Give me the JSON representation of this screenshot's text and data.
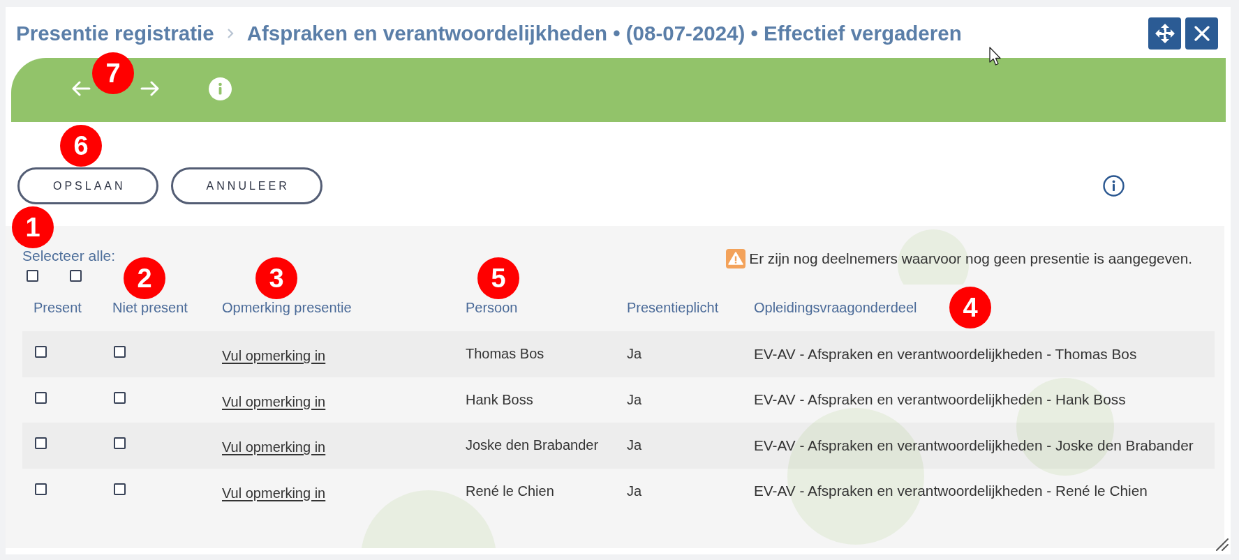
{
  "breadcrumb": [
    {
      "label": "Presentie registratie"
    },
    {
      "label": "Afspraken en verantwoordelijkheden • (08-07-2024) • Effectief vergaderen"
    }
  ],
  "actions": [
    {
      "label": "OPSLAAN"
    },
    {
      "label": "ANNULEER"
    }
  ],
  "select_all": {
    "label": "Selecteer alle:",
    "checkboxes": [
      {
        "checked": false
      },
      {
        "checked": false
      }
    ]
  },
  "warning": {
    "text": "Er zijn nog deelnemers waarvoor nog geen presentie is aangegeven."
  },
  "table": {
    "columns": [
      "Present",
      "Niet present",
      "Opmerking presentie",
      "Persoon",
      "Presentieplicht",
      "Opleidingsvraagonderdeel"
    ],
    "rows": [
      {
        "present_checked": false,
        "not_present_checked": false,
        "remark": "Vul opmerking in",
        "person": "Thomas Bos",
        "obligation": "Ja",
        "component": "EV-AV - Afspraken en verantwoordelijkheden - Thomas Bos"
      },
      {
        "present_checked": false,
        "not_present_checked": false,
        "remark": "Vul opmerking in",
        "person": "Hank Boss",
        "obligation": "Ja",
        "component": "EV-AV - Afspraken en verantwoordelijkheden - Hank Boss"
      },
      {
        "present_checked": false,
        "not_present_checked": false,
        "remark": "Vul opmerking in",
        "person": "Joske den Brabander",
        "obligation": "Ja",
        "component": "EV-AV - Afspraken en verantwoordelijkheden - Joske den Brabander"
      },
      {
        "present_checked": false,
        "not_present_checked": false,
        "remark": "Vul opmerking in",
        "person": "René le Chien",
        "obligation": "Ja",
        "component": "EV-AV - Afspraken en verantwoordelijkheden - René le Chien"
      }
    ]
  },
  "callouts": [
    {
      "label": "7"
    },
    {
      "label": "6"
    },
    {
      "label": "1"
    },
    {
      "label": "2"
    },
    {
      "label": "3"
    },
    {
      "label": "5"
    },
    {
      "label": "4"
    }
  ]
}
